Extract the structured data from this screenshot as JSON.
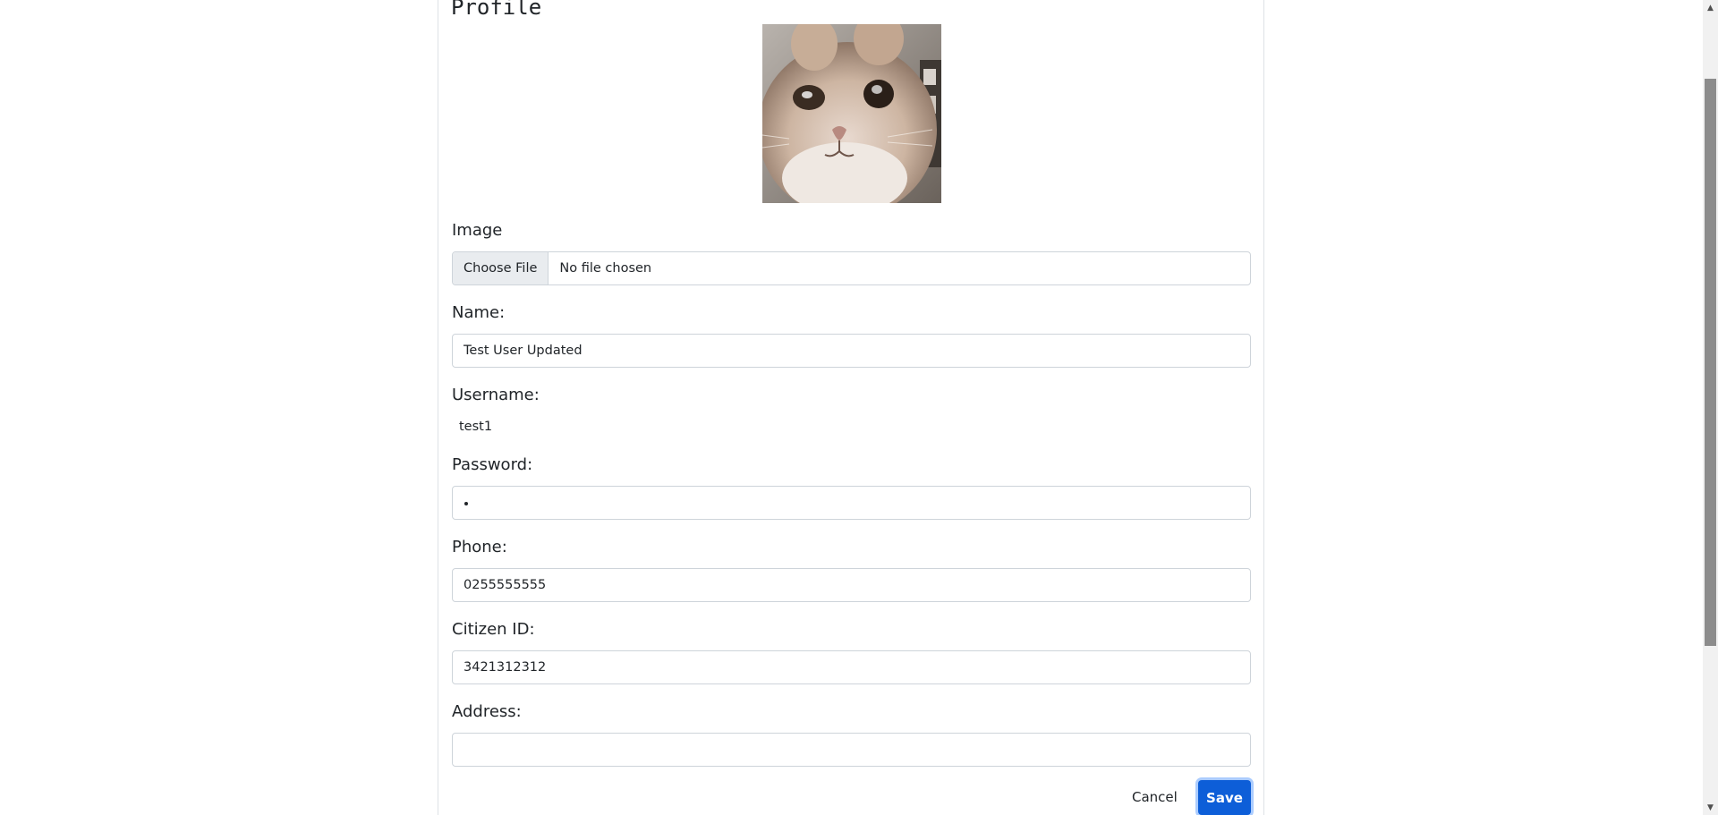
{
  "profile": {
    "title": "Profile"
  },
  "form": {
    "image_label": "Image",
    "file_button_label": "Choose File",
    "file_status": "No file chosen",
    "name_label": "Name:",
    "name_value": "Test User Updated",
    "username_label": "Username:",
    "username_value": "test1",
    "password_label": "Password:",
    "password_value": "•",
    "phone_label": "Phone:",
    "phone_value": "0255555555",
    "citizen_id_label": "Citizen ID:",
    "citizen_id_value": "3421312312",
    "address_label": "Address:",
    "address_value": ""
  },
  "actions": {
    "cancel_label": "Cancel",
    "save_label": "Save"
  },
  "colors": {
    "primary": "#0d5ed8",
    "border": "#ced4da",
    "text": "#212529"
  },
  "icons": {
    "scroll_up": "scroll-up-arrow-icon",
    "scroll_down": "scroll-down-arrow-icon"
  }
}
